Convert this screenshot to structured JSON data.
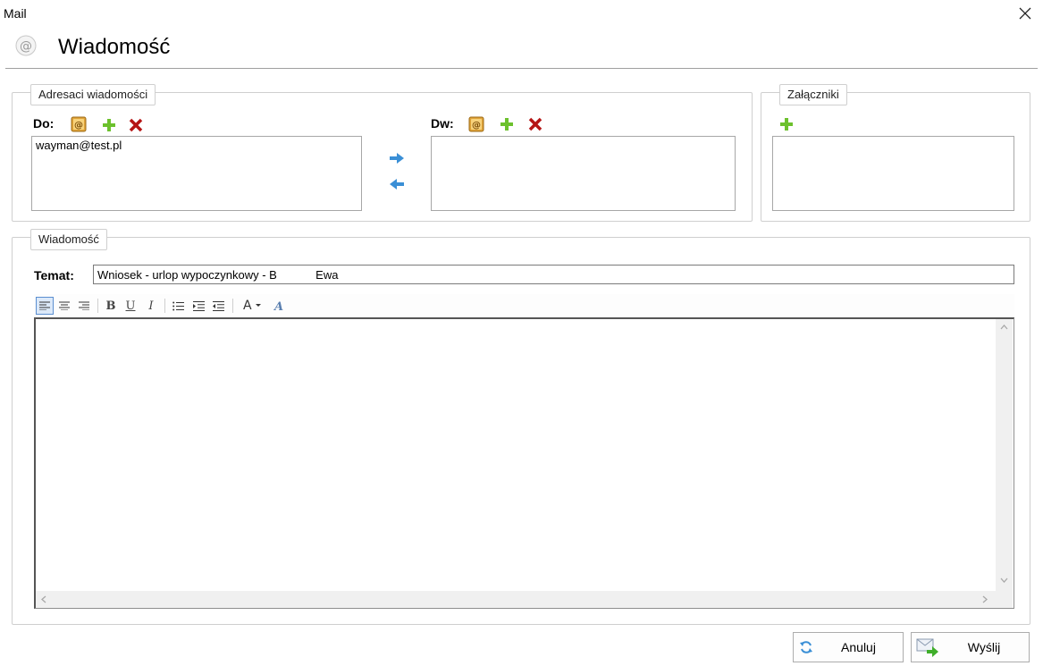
{
  "window": {
    "title": "Mail"
  },
  "header": {
    "title": "Wiadomość"
  },
  "recipients": {
    "legend": "Adresaci wiadomości",
    "to": {
      "label": "Do:",
      "items": [
        "wayman@test.pl"
      ]
    },
    "cc": {
      "label": "Dw:",
      "items": []
    }
  },
  "attachments": {
    "legend": "Załączniki",
    "items": []
  },
  "message": {
    "legend": "Wiadomość",
    "subject_label": "Temat:",
    "subject_value": "Wniosek - urlop wypoczynkowy - B            Ewa",
    "body": ""
  },
  "toolbar": {
    "bold": "B",
    "underline": "U",
    "italic": "I",
    "font_color": "A"
  },
  "footer": {
    "cancel_label": "Anuluj",
    "send_label": "Wyślij"
  },
  "colors": {
    "add": "#6cc12d",
    "remove": "#b51515",
    "arrow": "#3a8fd6",
    "border": "#cfcfcf"
  }
}
